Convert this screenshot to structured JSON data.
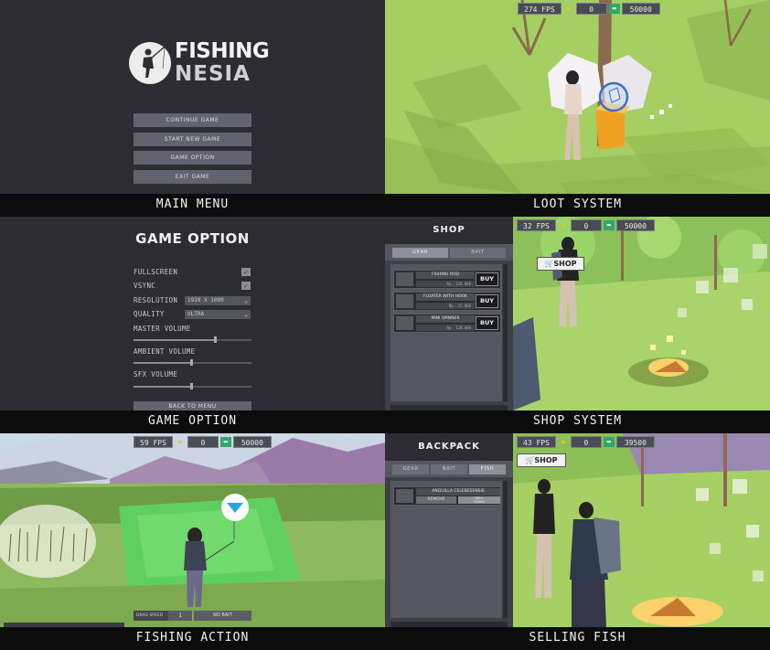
{
  "main_menu": {
    "logo_line1": "FISHING",
    "logo_line2": "NESIA",
    "buttons": [
      "CONTINUE GAME",
      "START NEW GAME",
      "GAME OPTION",
      "EXIT GAME"
    ],
    "caption": "MAIN MENU"
  },
  "loot": {
    "hud": {
      "fps": "274 FPS",
      "stars": "0",
      "money": "50000"
    },
    "caption": "LOOT SYSTEM"
  },
  "options": {
    "title": "GAME OPTION",
    "fullscreen_label": "FULLSCREEN",
    "vsync_label": "VSYNC",
    "resolution_label": "RESOLUTION",
    "resolution_value": "1920 X 1080",
    "quality_label": "QUALITY",
    "quality_value": "ULTRA",
    "master_label": "MASTER VOLUME",
    "master_level": 0.69,
    "ambient_label": "AMBIENT VOLUME",
    "ambient_level": 0.49,
    "sfx_label": "SFX VOLUME",
    "sfx_level": 0.49,
    "back_label": "BACK TO MENU",
    "caption": "GAME OPTION"
  },
  "shop": {
    "title": "SHOP",
    "tabs": [
      "GEAR",
      "BAIT"
    ],
    "items": [
      {
        "name": "FISHING ROD",
        "price": "Rp. 120.000",
        "buy": "BUY"
      },
      {
        "name": "FLOATER WITH HOOK",
        "price": "Rp. 35.000",
        "buy": "BUY"
      },
      {
        "name": "MINI SPINNER",
        "price": "Rp. 120.000",
        "buy": "BUY"
      }
    ],
    "hud": {
      "fps": "32 FPS",
      "stars": "0",
      "money": "50000"
    },
    "sign": "SHOP",
    "caption": "SHOP SYSTEM"
  },
  "fishing": {
    "hud": {
      "fps": "59 FPS",
      "stars": "0",
      "money": "50000"
    },
    "drag_label": "DRAG SPEED",
    "drag_value": "1",
    "bait_label": "NO BAIT",
    "caption": "FISHING ACTION"
  },
  "backpack": {
    "title": "BACKPACK",
    "tabs": [
      "GEAR",
      "BAIT",
      "FISH"
    ],
    "item_name": "ANGUILLA CELEBESENSIS",
    "remove_label": "REMOVE",
    "sell_label": "SELL",
    "sell_price": "50000",
    "hud": {
      "fps": "43 FPS",
      "stars": "0",
      "money": "39500"
    },
    "sign": "SHOP",
    "caption": "SELLING FISH"
  }
}
